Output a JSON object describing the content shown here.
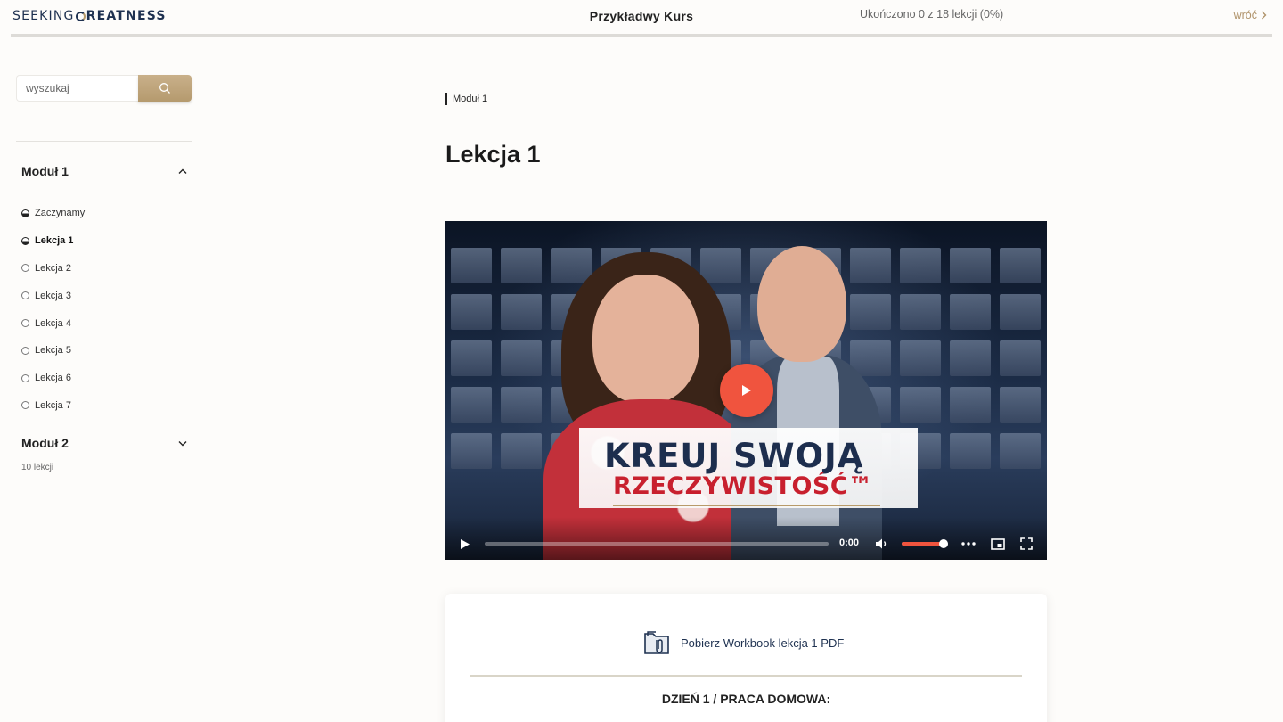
{
  "header": {
    "logo_light": "SEEKING",
    "logo_bold": "REATNESS",
    "course_title": "Przykładwy Kurs",
    "progress_text": "Ukończono 0 z 18 lekcji (0%)",
    "back_label": "wróć"
  },
  "sidebar": {
    "search_placeholder": "wyszukaj",
    "modules": [
      {
        "title": "Moduł 1",
        "expanded": true,
        "lessons": [
          {
            "label": "Zaczynamy",
            "status": "in-progress",
            "active": false
          },
          {
            "label": "Lekcja 1",
            "status": "in-progress",
            "active": true
          },
          {
            "label": "Lekcja 2",
            "status": "not-started",
            "active": false
          },
          {
            "label": "Lekcja 3",
            "status": "not-started",
            "active": false
          },
          {
            "label": "Lekcja 4",
            "status": "not-started",
            "active": false
          },
          {
            "label": "Lekcja 5",
            "status": "not-started",
            "active": false
          },
          {
            "label": "Lekcja 6",
            "status": "not-started",
            "active": false
          },
          {
            "label": "Lekcja 7",
            "status": "not-started",
            "active": false
          }
        ]
      },
      {
        "title": "Moduł 2",
        "expanded": false,
        "meta": "10 lekcji"
      }
    ]
  },
  "main": {
    "breadcrumb": "Moduł 1",
    "lesson_title": "Lekcja 1",
    "video": {
      "thumbnail_line1": "KREUJ SWOJĄ",
      "thumbnail_line2": "RZECZYWISTOŚĆ™",
      "time": "0:00",
      "volume_level": 0.9,
      "icons": [
        "play-icon",
        "volume-icon",
        "more-icon",
        "picture-in-picture-icon",
        "fullscreen-icon"
      ]
    },
    "card": {
      "download_label": "Pobierz Workbook lekcja 1 PDF",
      "heading": "DZIEŃ 1 / PRACA DOMOWA:"
    }
  },
  "colors": {
    "accent_gold": "#b89b6a",
    "brand_navy": "#1e3150",
    "play_orange": "#f0543e",
    "background": "#fdfcfa"
  }
}
